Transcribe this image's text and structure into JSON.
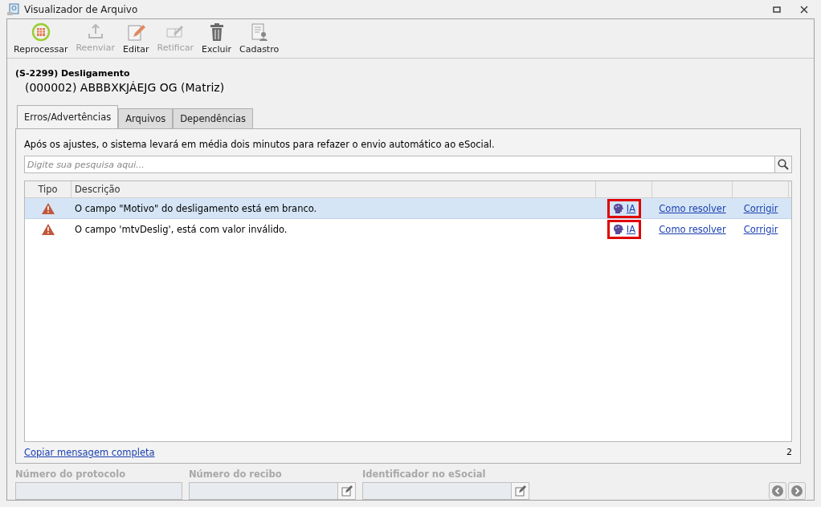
{
  "window": {
    "title": "Visualizador de Arquivo"
  },
  "toolbar": [
    {
      "label": "Reprocessar",
      "kind": "reprocess",
      "disabled": false
    },
    {
      "label": "Reenviar",
      "kind": "upload",
      "disabled": true
    },
    {
      "label": "Editar",
      "kind": "edit",
      "disabled": false
    },
    {
      "label": "Retificar",
      "kind": "rectify",
      "disabled": true
    },
    {
      "label": "Excluir",
      "kind": "delete",
      "disabled": false
    },
    {
      "label": "Cadastro",
      "kind": "register",
      "disabled": false
    }
  ],
  "header": {
    "event": "(S-2299) Desligamento",
    "employer": "(000002) ABBBXKJÁEJG OG (Matriz)"
  },
  "tabs": [
    {
      "label": "Erros/Advertências",
      "selected": true
    },
    {
      "label": "Arquivos",
      "selected": false
    },
    {
      "label": "Dependências",
      "selected": false
    }
  ],
  "notice": "Após os ajustes, o sistema levará em média dois minutos para refazer o envio automático ao eSocial.",
  "search": {
    "placeholder": "Digite sua pesquisa aqui..."
  },
  "table": {
    "columns": [
      "Tipo",
      "Descrição"
    ],
    "rows": [
      {
        "kind": "warning",
        "description": "O campo \"Motivo\" do desligamento está em branco.",
        "ai": "IA",
        "how_to": "Como resolver",
        "fix": "Corrigir",
        "selected": true,
        "highlighted": true
      },
      {
        "kind": "warning",
        "description": "O campo 'mtvDeslig', está com valor inválido.",
        "ai": "IA",
        "how_to": "Como resolver",
        "fix": "Corrigir",
        "selected": false,
        "highlighted": true
      }
    ]
  },
  "footer": {
    "copy_link": "Copiar mensagem completa",
    "count": "2"
  },
  "fields": [
    {
      "label": "Número do protocolo",
      "has_button": false,
      "disabled": true
    },
    {
      "label": "Número do recibo",
      "has_button": true,
      "disabled": true
    },
    {
      "label": "Identificador no eSocial",
      "has_button": true,
      "disabled": true
    }
  ]
}
